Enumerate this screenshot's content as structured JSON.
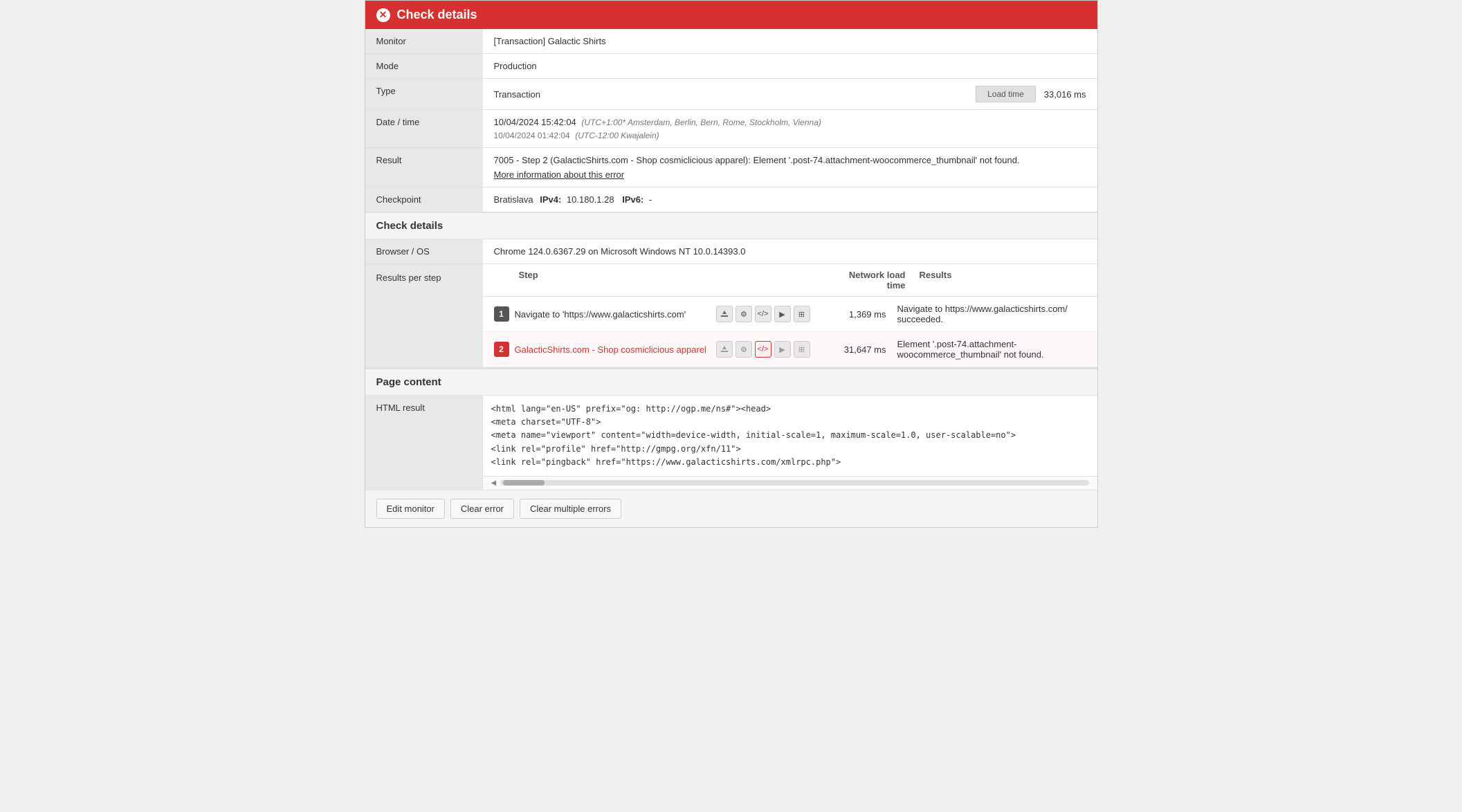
{
  "titleBar": {
    "title": "Check details",
    "closeIcon": "✕"
  },
  "infoTable": {
    "monitorLabel": "Monitor",
    "monitorValue": "[Transaction] Galactic Shirts",
    "modeLabel": "Mode",
    "modeValue": "Production",
    "typeLabel": "Type",
    "typeValue": "Transaction",
    "loadTimeLabel": "Load time",
    "loadTimeValue": "33,016 ms",
    "dateTimeLabel": "Date / time",
    "dateTimePrimary": "10/04/2024 15:42:04",
    "dateTimePrimaryNote": "(UTC+1:00* Amsterdam, Berlin, Bern, Rome, Stockholm, Vienna)",
    "dateTimeSecondary": "10/04/2024 01:42:04",
    "dateTimeSecondaryNote": "(UTC-12:00 Kwajalein)",
    "resultLabel": "Result",
    "resultValue": "7005 - Step 2 (GalacticShirts.com - Shop cosmiclicious apparel): Element '.post-74.attachment-woocommerce_thumbnail' not found.",
    "moreInfoLink": "More information about this error",
    "checkpointLabel": "Checkpoint",
    "checkpointText": "Bratislava",
    "checkpointIPv4Label": "IPv4:",
    "checkpointIPv4Value": "10.180.1.28",
    "checkpointIPv6Label": "IPv6:",
    "checkpointIPv6Value": "-"
  },
  "checkDetailsSection": {
    "title": "Check details",
    "browserOSLabel": "Browser / OS",
    "browserOSValue": "Chrome 124.0.6367.29 on Microsoft Windows NT 10.0.14393.0",
    "resultsPerStepLabel": "Results per step",
    "stepsTableHeaders": {
      "step": "Step",
      "networkLoadTime": "Network load time",
      "results": "Results"
    },
    "steps": [
      {
        "number": "1",
        "type": "success",
        "label": "Navigate to 'https://www.galacticshirts.com'",
        "networkTime": "1,369 ms",
        "result": "Navigate to https://www.galacticshirts.com/ succeeded."
      },
      {
        "number": "2",
        "type": "error",
        "label": "GalacticShirts.com - Shop cosmiclicious apparel",
        "networkTime": "31,647 ms",
        "result": "Element '.post-74.attachment-woocommerce_thumbnail' not found."
      }
    ],
    "stepIcons": [
      "📋",
      "⚙",
      "</>",
      "▶",
      "⊞"
    ]
  },
  "pageContentSection": {
    "title": "Page content",
    "htmlResultLabel": "HTML result",
    "htmlLines": [
      "<html lang=\"en-US\" prefix=\"og: http://ogp.me/ns#\"><head>",
      "<meta charset=\"UTF-8\">",
      "<meta name=\"viewport\" content=\"width=device-width, initial-scale=1, maximum-scale=1.0, user-scalable=no\">",
      "<link rel=\"profile\" href=\"http://gmpg.org/xfn/11\">",
      "<link rel=\"pingback\" href=\"https://www.galacticshirts.com/xmlrpc.php\">"
    ]
  },
  "footer": {
    "editMonitorLabel": "Edit monitor",
    "clearErrorLabel": "Clear error",
    "clearMultipleErrorsLabel": "Clear multiple errors"
  }
}
